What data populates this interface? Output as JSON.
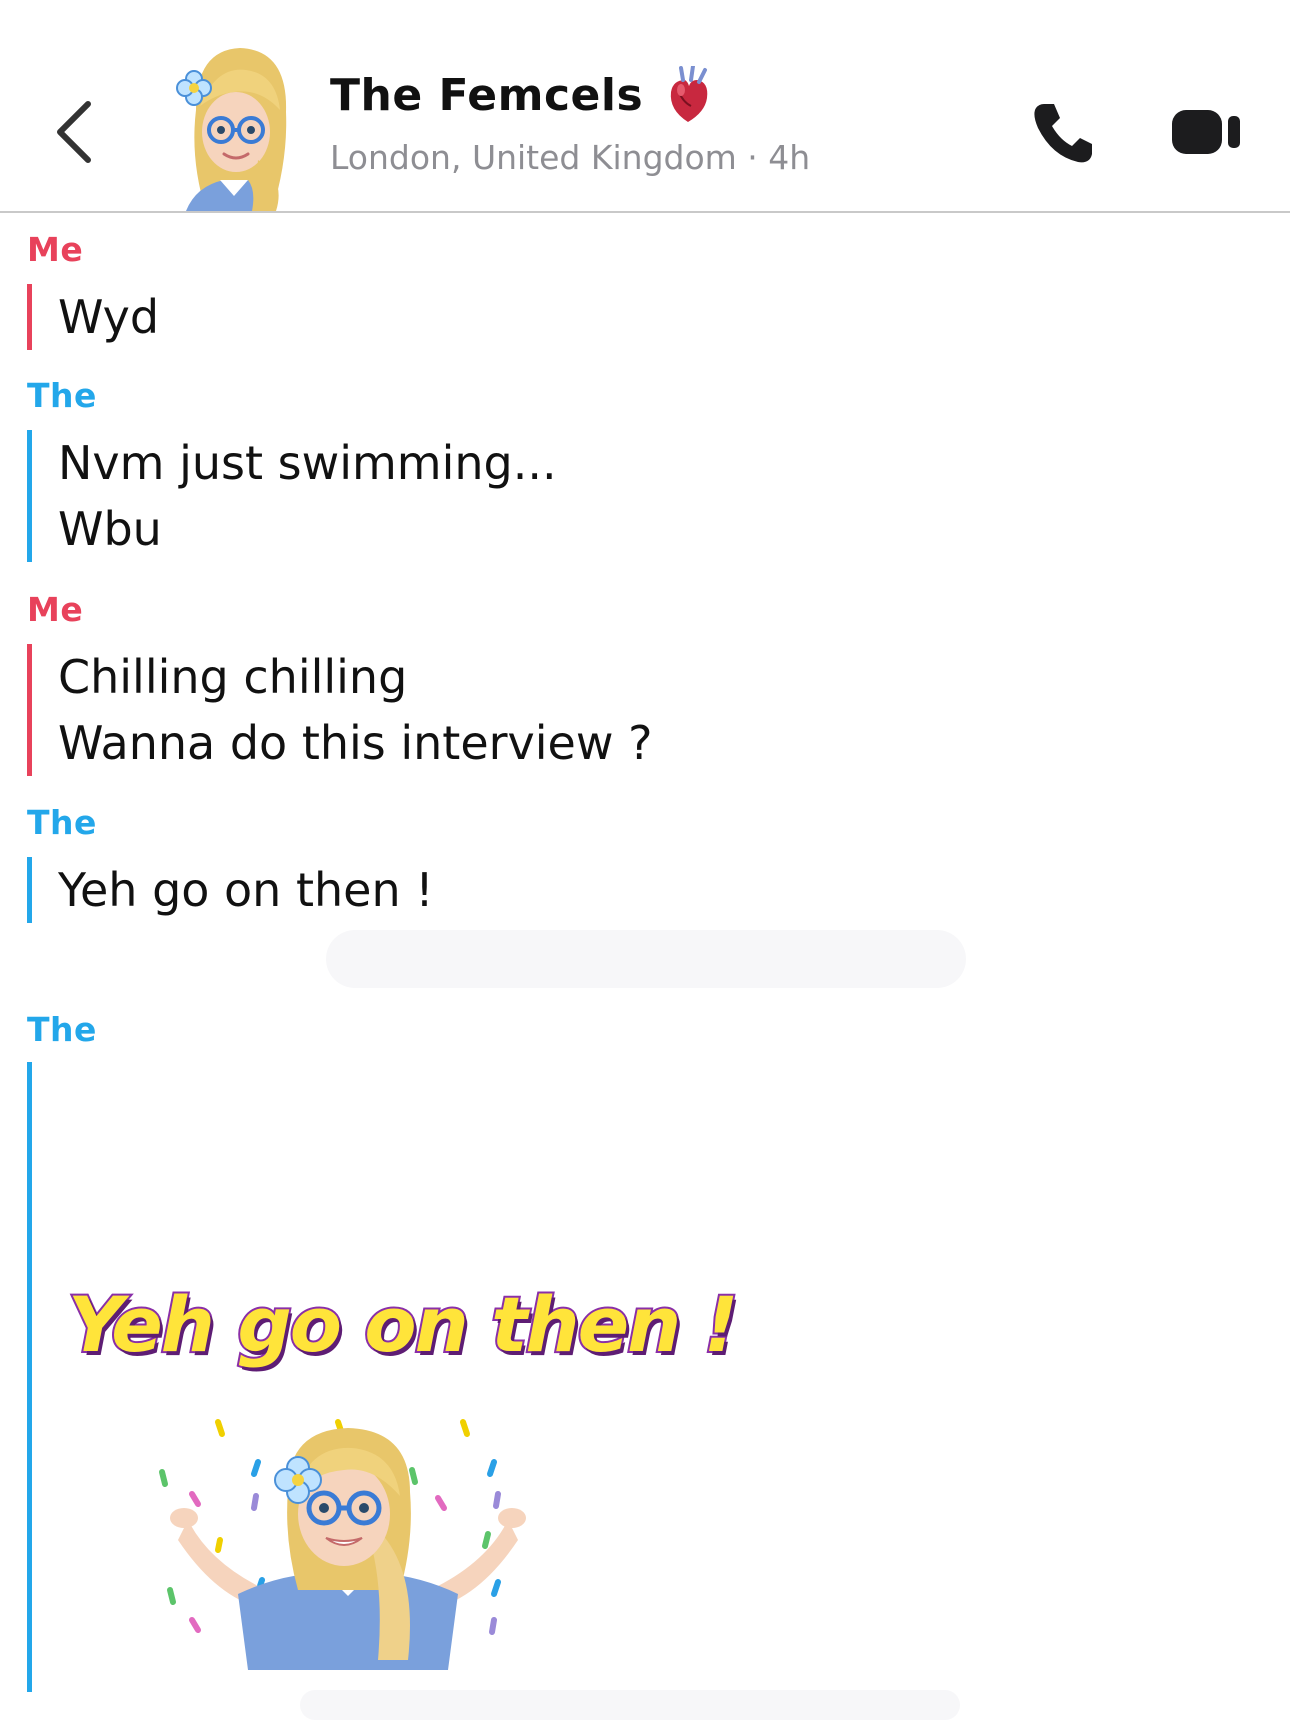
{
  "header": {
    "back_label": "",
    "title": "The Femcels",
    "title_emoji": "anatomical-heart",
    "subtitle": "London, United Kingdom · 4h",
    "call_icon": "phone-icon",
    "video_icon": "video-camera-icon"
  },
  "colors": {
    "me": "#e8425b",
    "them": "#23a7ea",
    "divider": "#c9c9c9"
  },
  "messages": [
    {
      "sender": "Me",
      "lines": [
        "Wyd"
      ]
    },
    {
      "sender": "The",
      "lines": [
        "Nvm just swimming...",
        "Wbu"
      ]
    },
    {
      "sender": "Me",
      "lines": [
        "Chilling chilling",
        "Wanna do this interview ?"
      ]
    },
    {
      "sender": "The",
      "lines": [
        "Yeh go on then !"
      ]
    },
    {
      "sender": "The",
      "sticker_text": "Yeh go on then !"
    }
  ]
}
